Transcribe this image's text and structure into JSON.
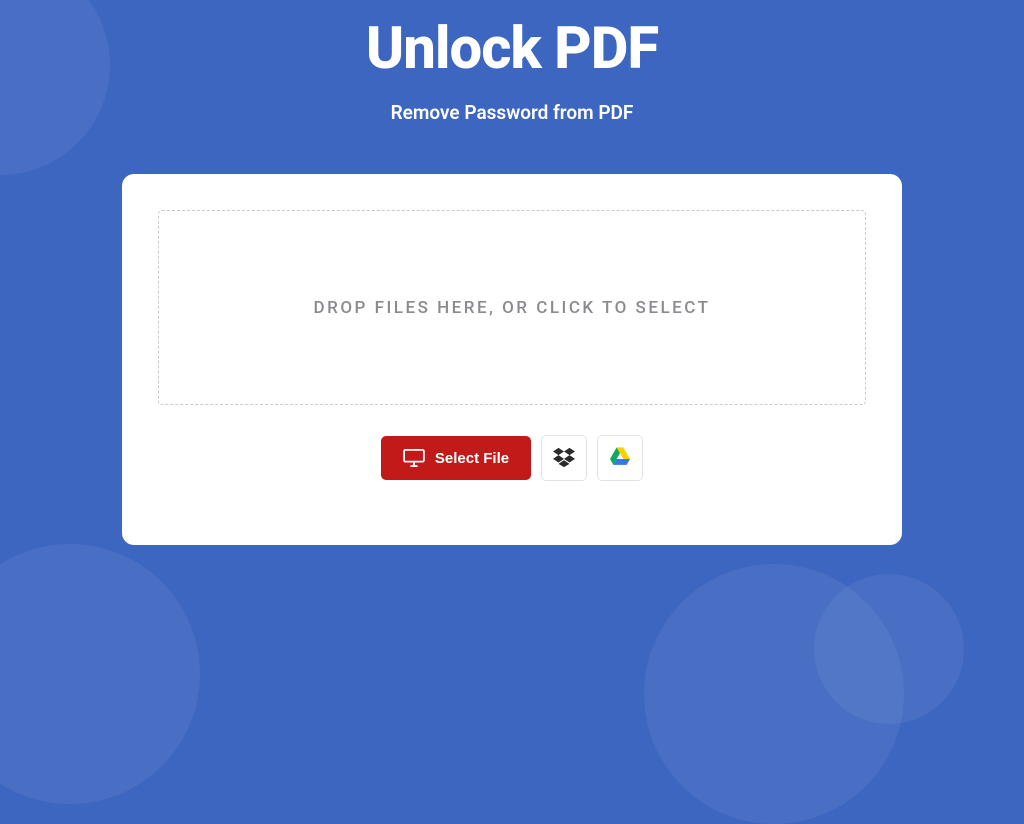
{
  "header": {
    "title": "Unlock PDF",
    "subtitle": "Remove Password from PDF"
  },
  "dropzone": {
    "text": "DROP FILES HERE, OR CLICK TO SELECT"
  },
  "buttons": {
    "select_file": "Select File"
  }
}
